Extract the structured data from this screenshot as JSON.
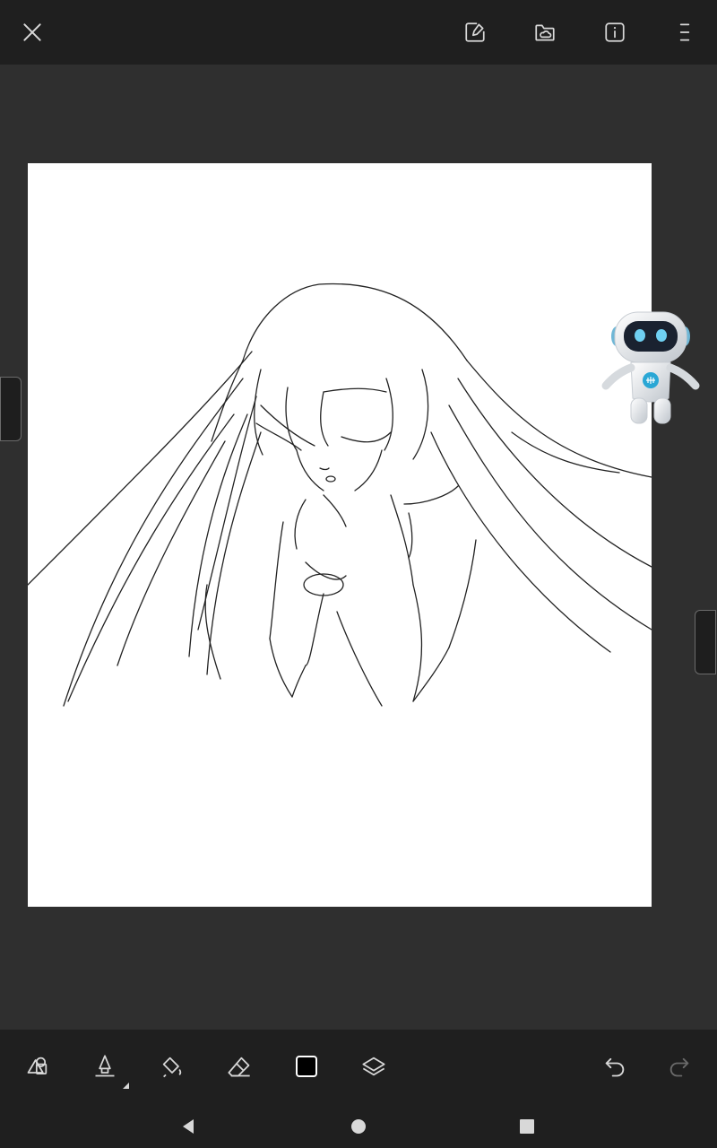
{
  "app": {
    "accent": "#ffffff",
    "background": "#2f2f2f",
    "bar_color": "#1f1f1f"
  },
  "topbar": {
    "close_icon": "close-icon",
    "actions": [
      "export-icon",
      "cloud-folder-icon",
      "info-icon",
      "menu-icon"
    ]
  },
  "canvas": {
    "background": "#ffffff",
    "content": "line-art-sketch"
  },
  "assistant": {
    "icon": "robot-assistant-icon"
  },
  "toolbar": {
    "tools": [
      "shape-tool-icon",
      "pen-tool-icon",
      "fill-tool-icon",
      "eraser-icon",
      "color-swatch",
      "layers-icon"
    ],
    "current_color": "#000000",
    "history": [
      "undo-icon",
      "redo-icon"
    ]
  },
  "navbar": {
    "buttons": [
      "back-icon",
      "home-icon",
      "recents-icon"
    ]
  }
}
